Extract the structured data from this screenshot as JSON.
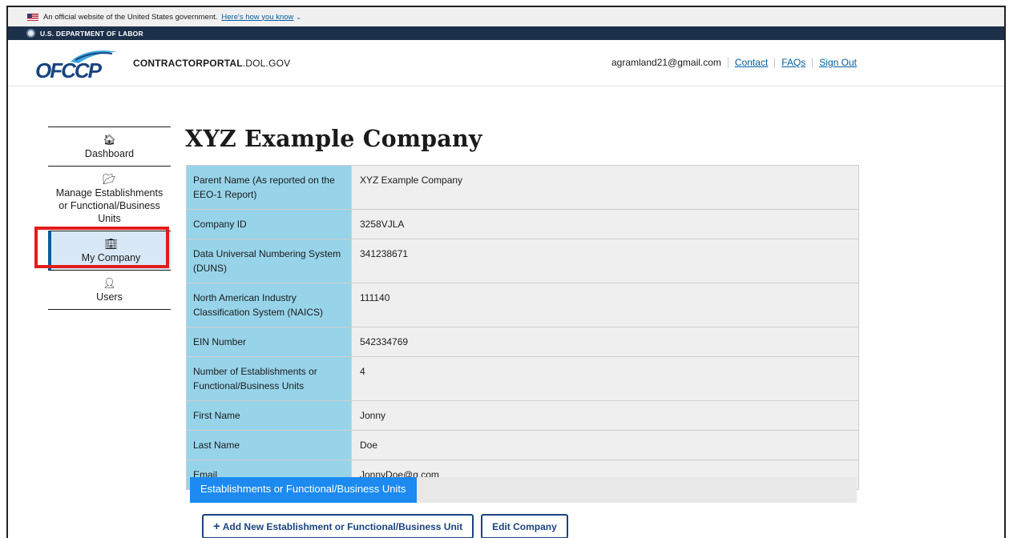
{
  "gov_banner": {
    "text": "An official website of the United States government.",
    "link": "Here's how you know",
    "chevron": "⌄"
  },
  "agency_bar": {
    "text": "U.S. DEPARTMENT OF LABOR"
  },
  "header": {
    "logo_text": "OFCCP",
    "portal_bold": "CONTRACTORPORTAL",
    "portal_light": ".DOL.GOV",
    "user_email": "agramland21@gmail.com",
    "contact": "Contact",
    "faqs": "FAQs",
    "sign_out": "Sign Out"
  },
  "sidebar": {
    "items": [
      {
        "icon": "home-icon",
        "glyph": "🏠︎",
        "label": "Dashboard"
      },
      {
        "icon": "folder-open-icon",
        "glyph": "📂︎",
        "label": "Manage Establishments or Functional/Business Units"
      },
      {
        "icon": "building-icon",
        "glyph": "🏢︎",
        "label": "My Company",
        "active": true
      },
      {
        "icon": "user-icon",
        "glyph": "👤︎",
        "label": "Users"
      }
    ]
  },
  "page": {
    "title": "XYZ Example Company"
  },
  "company_details": [
    {
      "label": "Parent Name (As reported on the EEO-1 Report)",
      "value": "XYZ Example Company"
    },
    {
      "label": "Company ID",
      "value": "3258VJLA"
    },
    {
      "label": "Data Universal Numbering System (DUNS)",
      "value": "341238671"
    },
    {
      "label": "North American Industry Classification System (NAICS)",
      "value": "111140"
    },
    {
      "label": "EIN Number",
      "value": "542334769"
    },
    {
      "label": "Number of Establishments or Functional/Business Units",
      "value": "4"
    },
    {
      "label": "First Name",
      "value": "Jonny"
    },
    {
      "label": "Last Name",
      "value": "Doe"
    },
    {
      "label": "Email",
      "value": "JonnyDoe@g.com"
    }
  ],
  "tabs": {
    "active": "Establishments or Functional/Business Units"
  },
  "actions": {
    "add_label": "Add New Establishment or Functional/Business Unit",
    "add_glyph": "+",
    "edit_label": "Edit Company"
  },
  "colors": {
    "label_cell": "#97d4ea",
    "value_cell": "#efefef",
    "tab_active": "#1c8af0",
    "primary": "#1a4480",
    "highlight": "#e21b1b"
  }
}
